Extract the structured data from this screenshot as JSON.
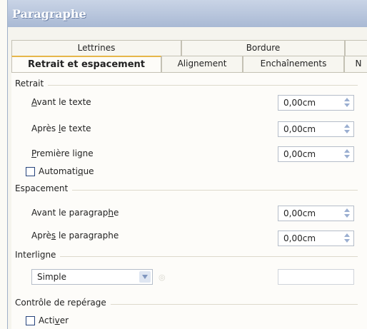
{
  "window": {
    "title": "Paragraphe"
  },
  "tabs_back": [
    "Lettrines",
    "Bordure"
  ],
  "tabs_front": [
    "Retrait et espacement",
    "Alignement",
    "Enchaînements",
    "N"
  ],
  "retrait": {
    "section": "Retrait",
    "avant_label_u": "A",
    "avant_label_rest": "vant le texte",
    "avant_value": "0,00cm",
    "apres_label_a": "Après ",
    "apres_label_u": "l",
    "apres_label_b": "e texte",
    "apres_value": "0,00cm",
    "premiere_label_u": "P",
    "premiere_label_rest": "remière ligne",
    "premiere_value": "0,00cm",
    "auto_label_a": "Automati",
    "auto_label_u": "q",
    "auto_label_b": "ue"
  },
  "espacement": {
    "section": "Espacement",
    "avant_label_a": "Avant le paragrap",
    "avant_label_u": "h",
    "avant_label_b": "e",
    "avant_value": "0,00cm",
    "apres_label_a": "Aprè",
    "apres_label_u": "s",
    "apres_label_b": " le paragraphe",
    "apres_value": "0,00cm"
  },
  "interligne": {
    "section": "Interligne",
    "value": "Simple",
    "de_value": ""
  },
  "controle": {
    "section": "Contrôle de repérage",
    "check_a": "Acti",
    "check_u": "v",
    "check_b": "er"
  }
}
